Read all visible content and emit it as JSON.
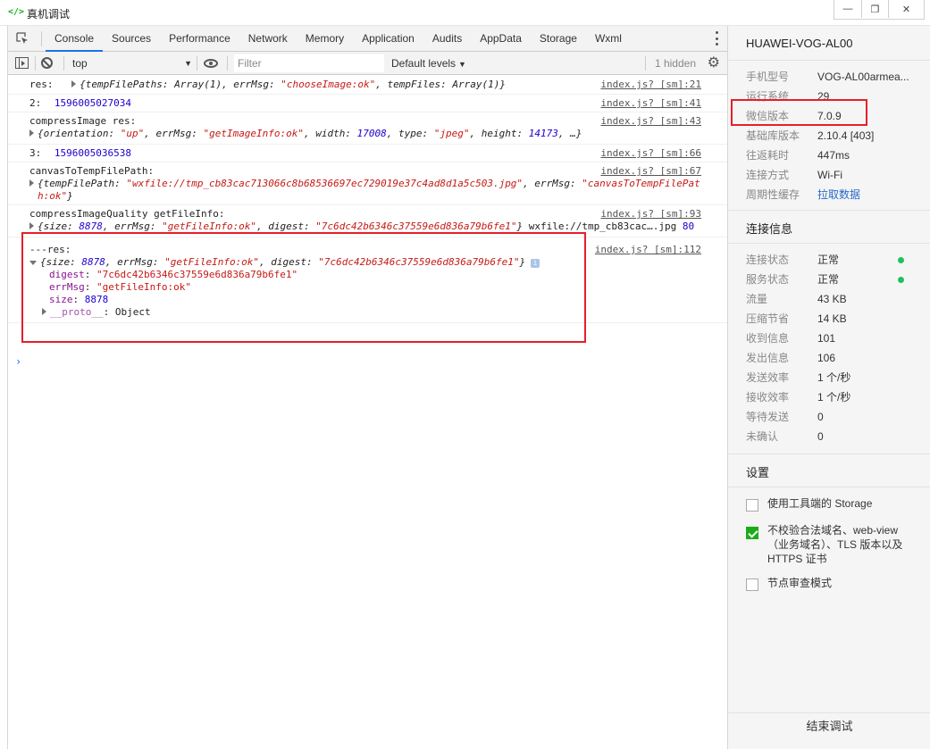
{
  "window": {
    "title": "真机调试",
    "app_icon": "</>",
    "minimize": "—",
    "restore": "❐",
    "close": "✕"
  },
  "tabs": [
    "Console",
    "Sources",
    "Performance",
    "Network",
    "Memory",
    "Application",
    "Audits",
    "AppData",
    "Storage",
    "Wxml"
  ],
  "toolbar": {
    "context": "top",
    "filter_placeholder": "Filter",
    "levels": "Default levels",
    "hidden": "1 hidden"
  },
  "console": {
    "m1": {
      "label": "res:",
      "text": "{tempFilePaths: Array(1), errMsg: ",
      "errmsg": "\"chooseImage:ok\"",
      "tail": ", tempFiles: Array(1)}",
      "src": "index.js? [sm]:21"
    },
    "m2": {
      "label": "2:",
      "value": "1596005027034",
      "src": "index.js? [sm]:41"
    },
    "m3": {
      "label": "compressImage res:",
      "src": "index.js? [sm]:43",
      "line": {
        "p1": "{orientation: ",
        "orientation": "\"up\"",
        "p2": ", errMsg: ",
        "errmsg": "\"getImageInfo:ok\"",
        "p3": ", width: ",
        "width": "17008",
        "p4": ", type: ",
        "type": "\"jpeg\"",
        "p5": ", height: ",
        "height": "14173",
        "p6": ", …}"
      }
    },
    "m4": {
      "label": "3:",
      "value": "1596005036538",
      "src": "index.js? [sm]:66"
    },
    "m5": {
      "label": "canvasToTempFilePath:",
      "src": "index.js? [sm]:67",
      "p1": "{tempFilePath: ",
      "path": "\"wxfile://tmp_cb83cac713066c8b68536697ec729019e37c4ad8d1a5c503.jpg\"",
      "p2": ", errMsg: ",
      "errmsg1": "\"canvasToTempFilePat",
      "errmsg2": "h:ok\"",
      "p3": "}"
    },
    "m6": {
      "label": "compressImageQuality getFileInfo:",
      "src": "index.js? [sm]:93",
      "p1": "{size: ",
      "size": "8878",
      "p2": ", errMsg: ",
      "errmsg": "\"getFileInfo:ok\"",
      "p3": ", digest: ",
      "digest": "\"7c6dc42b6346c37559e6d836a79b6fe1\"",
      "p4": "}",
      "extra1": " wxfile://tmp_cb83cac….jpg ",
      "extra2": "80"
    },
    "m7": {
      "label": "---res:",
      "src": "index.js? [sm]:112",
      "p1": "{size: ",
      "size": "8878",
      "p2": ", errMsg: ",
      "errmsg": "\"getFileInfo:ok\"",
      "p3": ", digest: ",
      "digest": "\"7c6dc42b6346c37559e6d836a79b6fe1\"",
      "p4": "}",
      "badge": "i",
      "props": {
        "digest_k": "digest",
        "digest_v": "\"7c6dc42b6346c37559e6d836a79b6fe1\"",
        "errmsg_k": "errMsg",
        "errmsg_v": "\"getFileInfo:ok\"",
        "size_k": "size",
        "size_v": "8878",
        "proto_k": "__proto__",
        "proto_v": "Object"
      }
    },
    "prompt": "›"
  },
  "panel": {
    "device": "HUAWEI-VOG-AL00",
    "info": [
      {
        "k": "手机型号",
        "v": "VOG-AL00armea..."
      },
      {
        "k": "运行系统",
        "v": "29"
      },
      {
        "k": "微信版本",
        "v": "7.0.9"
      },
      {
        "k": "基础库版本",
        "v": "2.10.4 [403]"
      },
      {
        "k": "往返耗时",
        "v": "447ms"
      },
      {
        "k": "连接方式",
        "v": "Wi-Fi"
      },
      {
        "k": "周期性缓存",
        "v": "拉取数据"
      }
    ],
    "conn_title": "连接信息",
    "conn": [
      {
        "k": "连接状态",
        "v": "正常"
      },
      {
        "k": "服务状态",
        "v": "正常"
      },
      {
        "k": "流量",
        "v": "43 KB"
      },
      {
        "k": "压缩节省",
        "v": "14 KB"
      },
      {
        "k": "收到信息",
        "v": "101"
      },
      {
        "k": "发出信息",
        "v": "106"
      },
      {
        "k": "发送效率",
        "v": "1 个/秒"
      },
      {
        "k": "接收效率",
        "v": "1 个/秒"
      },
      {
        "k": "等待发送",
        "v": "0"
      },
      {
        "k": "未确认",
        "v": "0"
      }
    ],
    "settings_title": "设置",
    "settings": [
      {
        "label": "使用工具端的 Storage",
        "checked": false
      },
      {
        "label": "不校验合法域名、web-view（业务域名）、TLS 版本以及 HTTPS 证书",
        "checked": true
      },
      {
        "label": "节点审查模式",
        "checked": false
      }
    ],
    "end_button": "结束调试"
  },
  "colors": {
    "accent": "#1a73e8",
    "highlight": "#e5202a",
    "ok": "#21c15e",
    "wechat_green": "#1aad19"
  }
}
